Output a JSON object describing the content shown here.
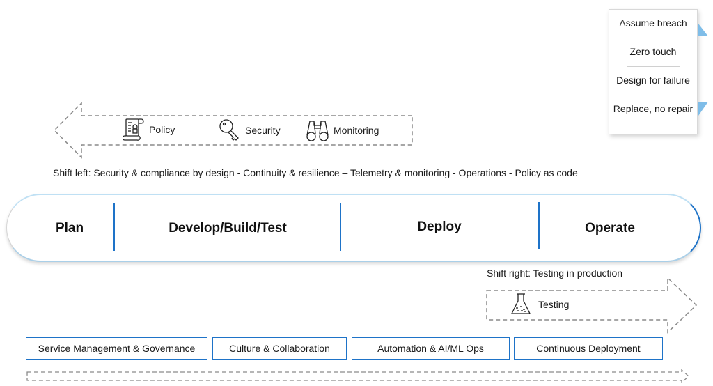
{
  "principles": {
    "items": [
      "Assume breach",
      "Zero touch",
      "Design for failure",
      "Replace, no repair"
    ]
  },
  "shift_left": {
    "tools": [
      {
        "icon": "policy-scroll-icon",
        "label": "Policy"
      },
      {
        "icon": "key-icon",
        "label": "Security"
      },
      {
        "icon": "binoculars-icon",
        "label": "Monitoring"
      }
    ],
    "caption": "Shift left: Security & compliance by design - Continuity & resilience – Telemetry & monitoring - Operations - Policy as code"
  },
  "pipeline": {
    "stages": [
      "Plan",
      "Develop/Build/Test",
      "Deploy",
      "Operate"
    ]
  },
  "shift_right": {
    "caption": "Shift right: Testing in production",
    "tools": [
      {
        "icon": "flask-icon",
        "label": "Testing"
      }
    ]
  },
  "pillars": [
    "Service Management & Governance",
    "Culture & Collaboration",
    "Automation & AI/ML Ops",
    "Continuous Deployment"
  ],
  "colors": {
    "accent_blue": "#1e73c8",
    "light_blue": "#7fbde8",
    "dash_gray": "#8a8a8a"
  }
}
